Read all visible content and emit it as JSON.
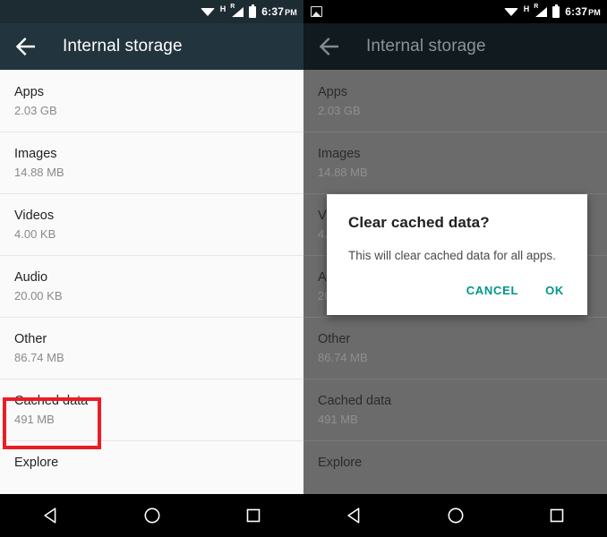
{
  "status_bar": {
    "time": "6:37",
    "ampm": "PM",
    "network_type": "H",
    "roaming": "R",
    "icons": [
      "screenshot-icon",
      "wifi-icon",
      "network-h-icon",
      "signal-icon",
      "battery-icon"
    ]
  },
  "app_bar": {
    "back_label": "Back",
    "title": "Internal storage"
  },
  "storage_rows": [
    {
      "title": "Apps",
      "size": "2.03 GB"
    },
    {
      "title": "Images",
      "size": "14.88 MB"
    },
    {
      "title": "Videos",
      "size": "4.00 KB"
    },
    {
      "title": "Audio",
      "size": "20.00 KB"
    },
    {
      "title": "Other",
      "size": "86.74 MB"
    },
    {
      "title": "Cached data",
      "size": "491 MB"
    },
    {
      "title": "Explore",
      "size": ""
    }
  ],
  "highlight": {
    "target": "Cached data",
    "color": "#ed1c24"
  },
  "dialog": {
    "title": "Clear cached data?",
    "message": "This will clear cached data for all apps.",
    "cancel_label": "CANCEL",
    "ok_label": "OK",
    "accent_color": "#009688"
  },
  "nav_bar": {
    "back": "back-nav",
    "home": "home-nav",
    "recents": "recents-nav"
  },
  "theme": {
    "appbar_bg": "#22343d",
    "statusbar_bg": "#1d2b33",
    "list_bg": "#fafafa",
    "scrim_list_bg": "#6b6b6b"
  }
}
